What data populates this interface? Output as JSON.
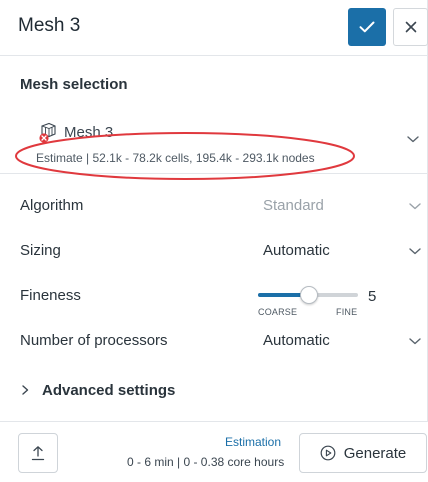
{
  "header": {
    "title": "Mesh 3",
    "confirm_icon": "check-icon",
    "close_icon": "close-icon",
    "accent_color": "#1b6fa8"
  },
  "mesh_selection": {
    "title": "Mesh selection",
    "mesh_name": "Mesh 3",
    "mesh_icon": "mesh-icon",
    "estimate": "Estimate | 52.1k - 78.2k cells, 195.4k - 293.1k nodes",
    "highlight_color": "#e0393e"
  },
  "form": {
    "algorithm": {
      "label": "Algorithm",
      "value": "Standard"
    },
    "sizing": {
      "label": "Sizing",
      "value": "Automatic"
    },
    "fineness": {
      "label": "Fineness",
      "value": "5",
      "min_label": "COARSE",
      "max_label": "FINE",
      "level": 0.5
    },
    "processors": {
      "label": "Number of processors",
      "value": "Automatic"
    }
  },
  "advanced": {
    "label": "Advanced settings"
  },
  "footer": {
    "upload_icon": "upload-icon",
    "estimation_label": "Estimation",
    "estimation_detail": "0 - 6 min | 0 - 0.38 core hours",
    "generate_label": "Generate",
    "generate_icon": "play-circle-icon"
  }
}
